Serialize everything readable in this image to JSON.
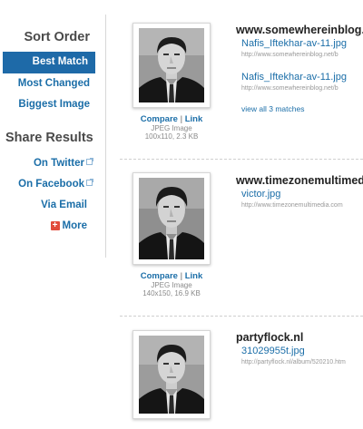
{
  "sidebar": {
    "sort_title": "Sort Order",
    "sort_items": [
      {
        "label": "Best Match",
        "active": true
      },
      {
        "label": "Most Changed",
        "active": false
      },
      {
        "label": "Biggest Image",
        "active": false
      }
    ],
    "share_title": "Share Results",
    "share_items": [
      {
        "label": "On Twitter",
        "icon": "external-link-icon"
      },
      {
        "label": "On Facebook",
        "icon": "external-link-icon"
      },
      {
        "label": "Via Email",
        "icon": ""
      },
      {
        "label": "More",
        "icon": "plus-icon"
      }
    ]
  },
  "results": [
    {
      "site": "www.somewhereinblog.",
      "compare_label": "Compare",
      "link_label": "Link",
      "image_type": "JPEG Image",
      "image_size": "100x110, 2.3 KB",
      "matches": [
        {
          "name": "Nafis_Iftekhar-av-11.jpg",
          "url": "http://www.somewhereinblog.net/b"
        },
        {
          "name": "Nafis_Iftekhar-av-11.jpg",
          "url": "http://www.somewhereinblog.net/b"
        }
      ],
      "view_all": "view all 3 matches"
    },
    {
      "site": "www.timezonemultimed",
      "compare_label": "Compare",
      "link_label": "Link",
      "image_type": "JPEG Image",
      "image_size": "140x150, 16.9 KB",
      "matches": [
        {
          "name": "victor.jpg",
          "url": "http://www.timezonemultimedia.com"
        }
      ]
    },
    {
      "site": "partyflock.nl",
      "matches": [
        {
          "name": "31029955t.jpg",
          "url": "http://partyflock.nl/album/520210.htm"
        }
      ]
    }
  ],
  "colors": {
    "accent": "#1e6aa8",
    "link": "#1b6ea8",
    "more_icon": "#e14b3b"
  }
}
